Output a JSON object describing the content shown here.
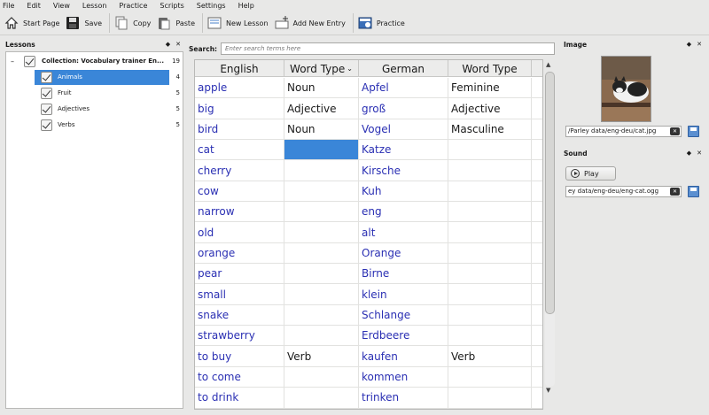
{
  "menu": [
    "File",
    "Edit",
    "View",
    "Lesson",
    "Practice",
    "Scripts",
    "Settings",
    "Help"
  ],
  "toolbar": {
    "start_page": "Start Page",
    "save": "Save",
    "copy": "Copy",
    "paste": "Paste",
    "new_lesson": "New Lesson",
    "add_new_entry": "Add New Entry",
    "practice": "Practice"
  },
  "lessons": {
    "title": "Lessons",
    "collection": {
      "label": "Collection: Vocabulary trainer En...",
      "count": "19"
    },
    "items": [
      {
        "label": "Animals",
        "count": "4",
        "selected": true
      },
      {
        "label": "Fruit",
        "count": "5"
      },
      {
        "label": "Adjectives",
        "count": "5"
      },
      {
        "label": "Verbs",
        "count": "5"
      }
    ]
  },
  "search": {
    "label": "Search:",
    "placeholder": "Enter search terms here"
  },
  "table": {
    "columns": [
      "English",
      "Word Type",
      "German",
      "Word Type"
    ],
    "rows": [
      [
        "apple",
        "Noun",
        "Apfel",
        "Feminine"
      ],
      [
        "big",
        "Adjective",
        "groß",
        "Adjective"
      ],
      [
        "bird",
        "Noun",
        "Vogel",
        "Masculine"
      ],
      [
        "cat",
        "",
        "Katze",
        ""
      ],
      [
        "cherry",
        "",
        "Kirsche",
        ""
      ],
      [
        "cow",
        "",
        "Kuh",
        ""
      ],
      [
        "narrow",
        "",
        "eng",
        ""
      ],
      [
        "old",
        "",
        "alt",
        ""
      ],
      [
        "orange",
        "",
        "Orange",
        ""
      ],
      [
        "pear",
        "",
        "Birne",
        ""
      ],
      [
        "small",
        "",
        "klein",
        ""
      ],
      [
        "snake",
        "",
        "Schlange",
        ""
      ],
      [
        "strawberry",
        "",
        "Erdbeere",
        ""
      ],
      [
        "to buy",
        "Verb",
        "kaufen",
        "Verb"
      ],
      [
        "to come",
        "",
        "kommen",
        ""
      ],
      [
        "to drink",
        "",
        "trinken",
        ""
      ]
    ]
  },
  "image_panel": {
    "title": "Image",
    "path": "/Parley data/eng-deu/cat.jpg"
  },
  "sound_panel": {
    "title": "Sound",
    "play": "Play",
    "path": "ey data/eng-deu/eng-cat.ogg"
  }
}
